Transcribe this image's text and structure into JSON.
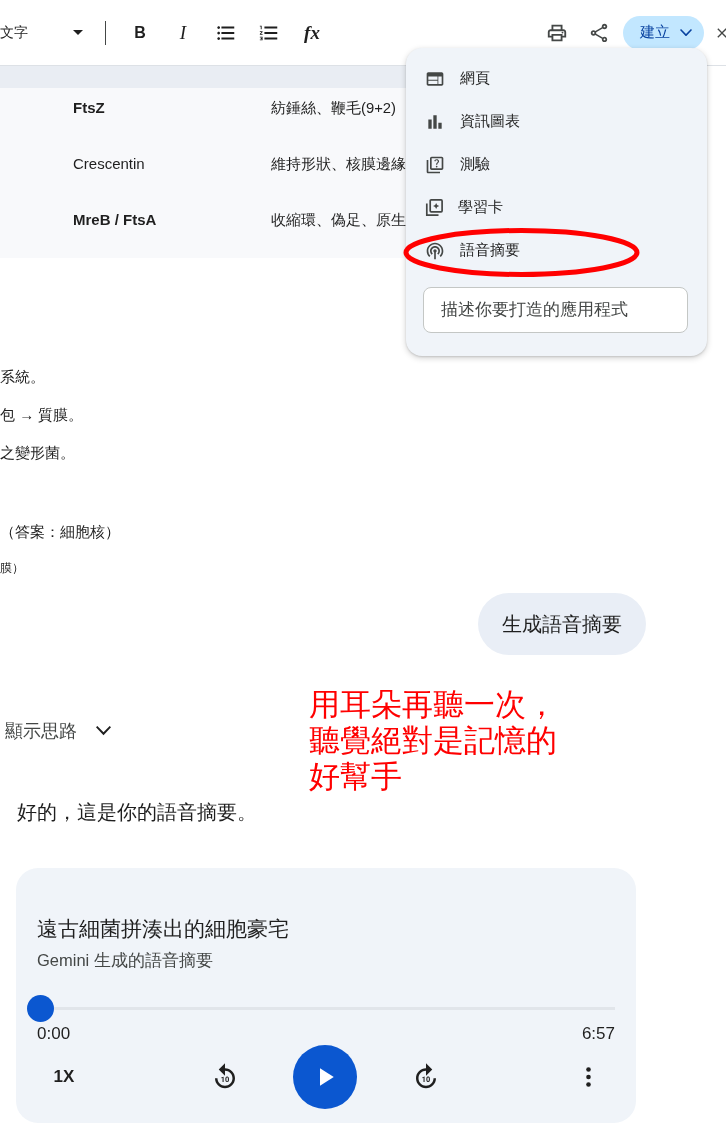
{
  "toolbar": {
    "style_select": {
      "value": "文字"
    },
    "format_buttons": [
      {
        "kind": "bold",
        "label": "B"
      },
      {
        "kind": "italic",
        "label": "I"
      },
      {
        "kind": "bullets"
      },
      {
        "kind": "numbered"
      },
      {
        "kind": "formula",
        "label": "fx"
      }
    ],
    "create_button": {
      "label": "建立",
      "expanded": true
    }
  },
  "table": {
    "rows": [
      {
        "column_1": "FtsZ",
        "column_2": "紡錘絲、鞭毛(9+2)",
        "bold": true
      },
      {
        "column_1": "Crescentin",
        "column_2": "維持形狀、核膜邊緣",
        "bold": false
      },
      {
        "column_1": "MreB / FtsA",
        "column_2": "收縮環、偽足、原生",
        "bold": true
      }
    ]
  },
  "document": {
    "blocks": [
      {
        "lines": [
          {
            "kind": "body",
            "text": "系統。"
          },
          {
            "kind": "body",
            "text": "包 → 質膜。"
          },
          {
            "kind": "body",
            "text": "之變形菌。"
          }
        ]
      },
      {
        "lines": [
          {
            "kind": "body",
            "text": "（答案：細胞核）"
          },
          {
            "kind": "note",
            "text": "膜）"
          }
        ]
      }
    ]
  },
  "create_menu": {
    "items": [
      {
        "kind": "webpage",
        "label": "網頁",
        "circled": false
      },
      {
        "kind": "infographic",
        "label": "資訊圖表",
        "circled": false
      },
      {
        "kind": "quiz",
        "label": "測驗",
        "circled": false
      },
      {
        "kind": "flashcards",
        "label": "學習卡",
        "circled": false
      },
      {
        "kind": "audio",
        "label": "語音摘要",
        "circled": true
      }
    ],
    "prompt_field": {
      "placeholder": "描述你要打造的應用程式"
    }
  },
  "chat": {
    "user_message": "生成語音摘要",
    "thinking_toggle": {
      "label": "顯示思路",
      "expanded": false
    },
    "response": "好的，這是你的語音摘要。"
  },
  "annotation": {
    "text": "用耳朵再聽一次，聽覺絕對是記憶的好幫手"
  },
  "audio_player": {
    "title": "遠古細菌拼湊出的細胞豪宅",
    "subtitle": "Gemini 生成的語音摘要",
    "progress": {
      "level": 0
    },
    "elapsed": "0:00",
    "duration": "6:57",
    "speed": "1X"
  }
}
